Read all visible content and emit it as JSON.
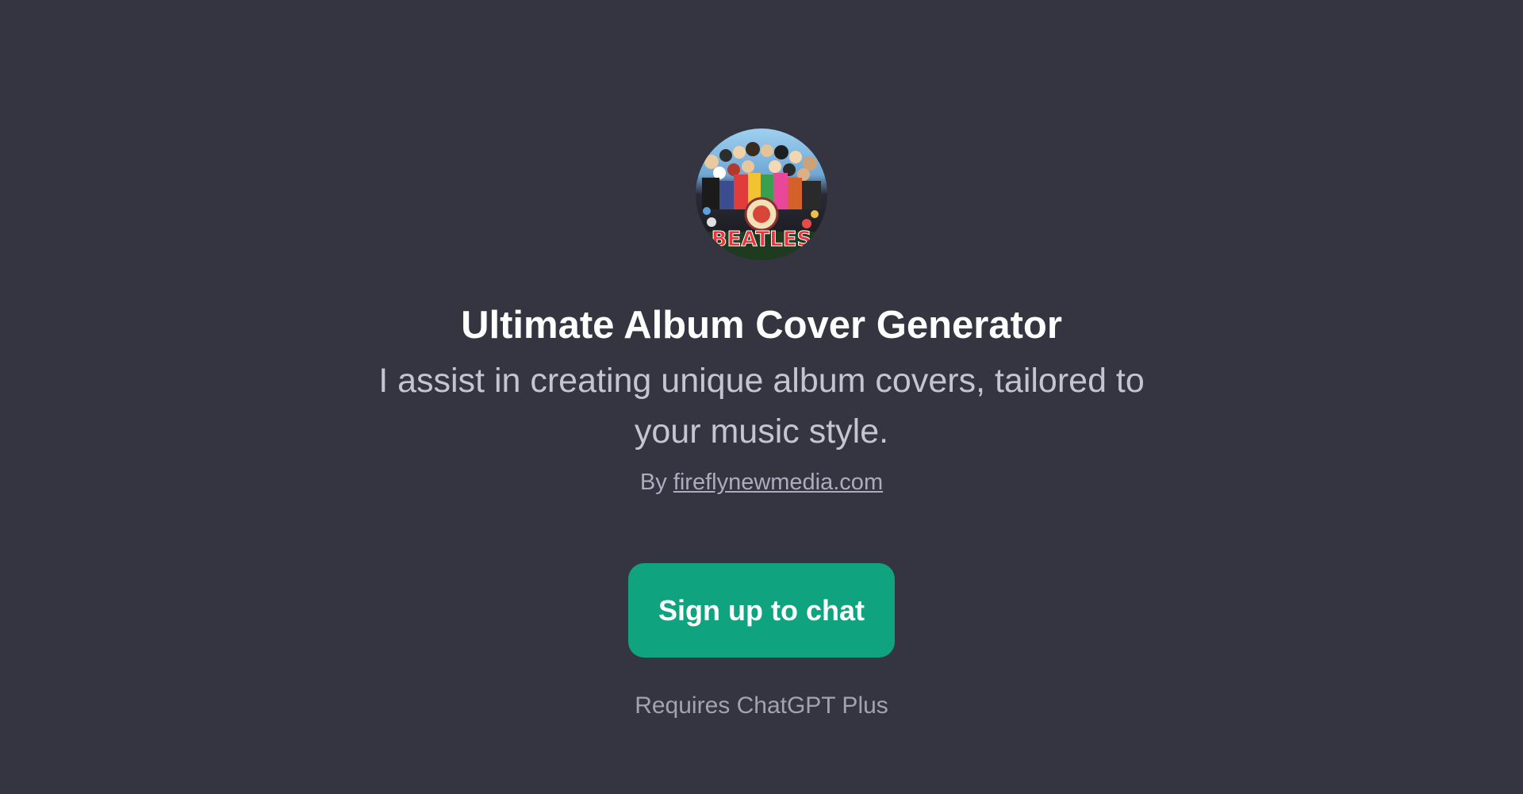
{
  "gpt": {
    "title": "Ultimate Album Cover Generator",
    "description": "I assist in creating unique album covers, tailored to your music style.",
    "byline_prefix": "By",
    "author": "fireflynewmedia.com",
    "avatar_icon": "album-cover-avatar",
    "avatar_text": "BEATLES"
  },
  "cta": {
    "signup_label": "Sign up to chat",
    "requirement": "Requires ChatGPT Plus"
  },
  "colors": {
    "background": "#343541",
    "button": "#10a37f",
    "title": "#ffffff",
    "description": "#c5c5d2",
    "muted": "#acacbe"
  }
}
